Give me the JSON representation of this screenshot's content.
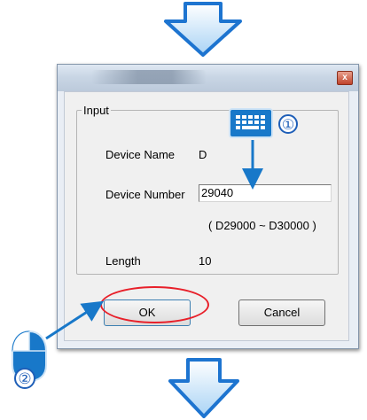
{
  "dialog": {
    "close_glyph": "x",
    "group_label": "Input",
    "device_name_label": "Device Name",
    "device_name_value": "D",
    "device_number_label": "Device Number",
    "device_number_value": "29040",
    "range_text": "( D29000 ~ D30000 )",
    "length_label": "Length",
    "length_value": "10",
    "ok_label": "OK",
    "cancel_label": "Cancel"
  },
  "annotations": {
    "step1": "①",
    "step2": "②",
    "highlight_color": "#e8202a",
    "arrow_color": "#1878c9"
  },
  "icons": {
    "top_arrow": "down-arrow-icon",
    "bottom_arrow": "down-arrow-icon",
    "keyboard": "keyboard-icon",
    "mouse": "mouse-icon"
  }
}
